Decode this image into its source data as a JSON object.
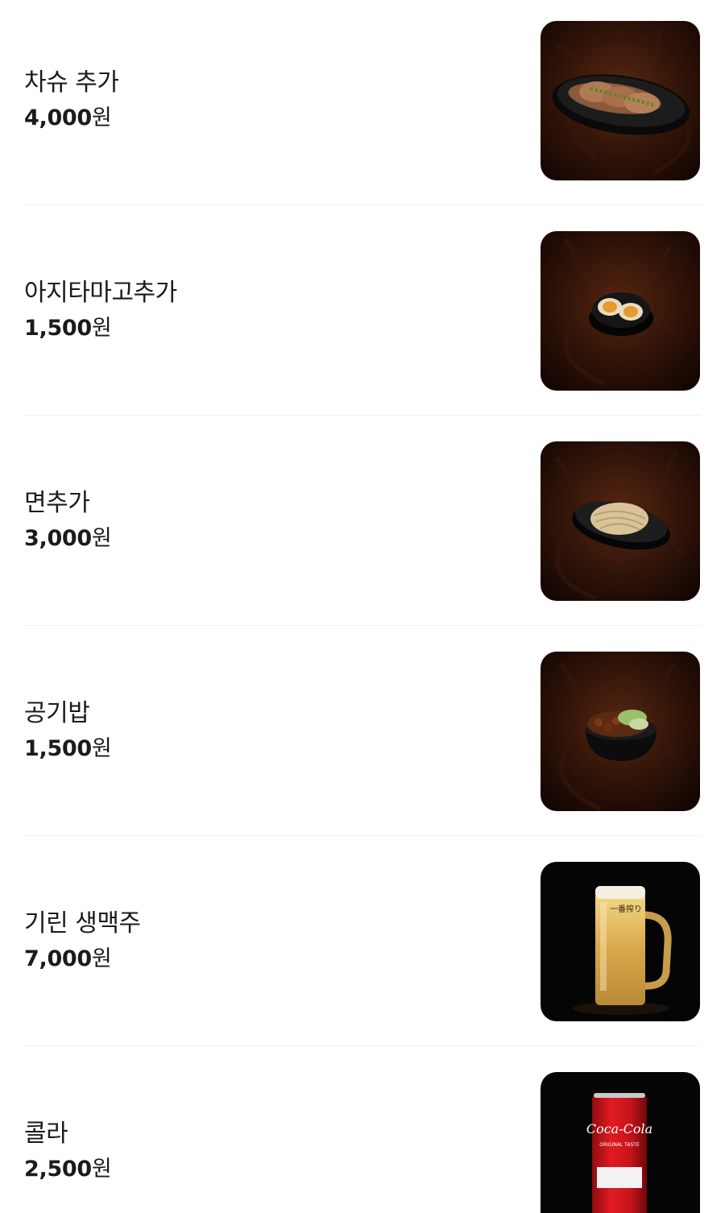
{
  "menu": {
    "currency_suffix": "원",
    "items": [
      {
        "name": "차슈 추가",
        "price": "4,000",
        "photo": "chashu-plate-photo"
      },
      {
        "name": "아지타마고추가",
        "price": "1,500",
        "photo": "soft-boiled-egg-photo"
      },
      {
        "name": "면추가",
        "price": "3,000",
        "photo": "noodle-plate-photo"
      },
      {
        "name": "공기밥",
        "price": "1,500",
        "photo": "rice-bowl-photo"
      },
      {
        "name": "기린 생맥주",
        "price": "7,000",
        "photo": "draft-beer-mug-photo"
      },
      {
        "name": "콜라",
        "price": "2,500",
        "photo": "cola-can-photo"
      }
    ]
  },
  "colors": {
    "text": "#1b1b1b",
    "divider": "#f1f1f1",
    "wood_dark": "#1c0b05",
    "wood_mid": "#4a1f0e",
    "black_bg": "#050505"
  },
  "can_label": {
    "brand": "Coca-Cola",
    "subtitle": "ORIGINAL TASTE"
  },
  "mug_label": "一番搾り"
}
